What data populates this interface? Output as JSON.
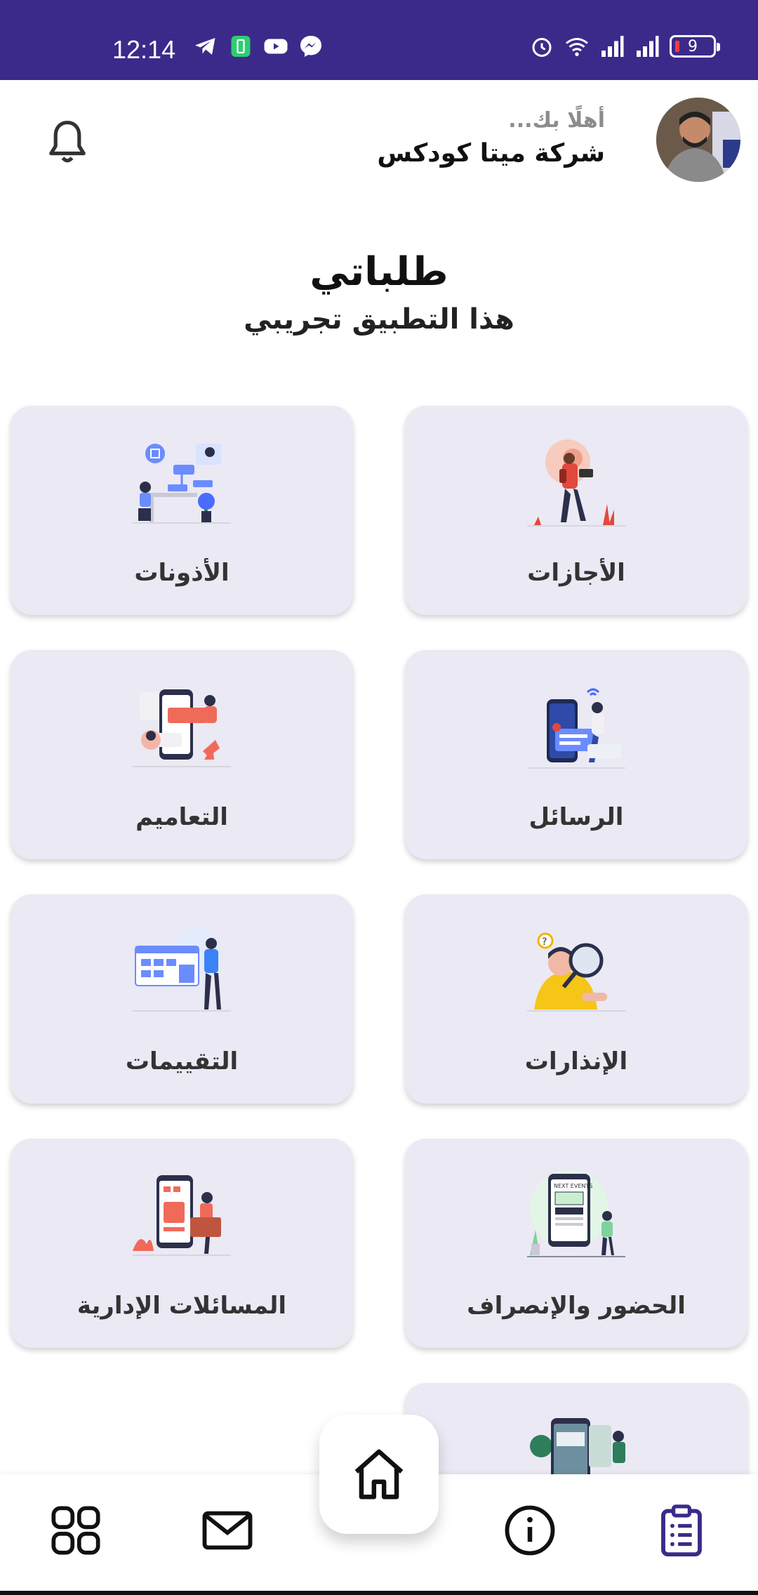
{
  "status_bar": {
    "time": "12:14",
    "battery_level": "9",
    "left_icons": [
      "telegram-icon",
      "battery-saver-icon",
      "youtube-icon",
      "messenger-icon"
    ],
    "right_icons": [
      "alarm-icon",
      "wifi-icon",
      "signal-icon",
      "signal-icon",
      "battery-icon"
    ]
  },
  "header": {
    "greeting": "أهلًا بك...",
    "company": "شركة ميتا كودكس"
  },
  "page": {
    "title": "طلباتي",
    "subtitle": "هذا التطبيق تجريبي"
  },
  "cards": [
    {
      "label": "الأجازات"
    },
    {
      "label": "الأذونات"
    },
    {
      "label": "الرسائل"
    },
    {
      "label": "التعاميم"
    },
    {
      "label": "الإنذارات"
    },
    {
      "label": "التقييمات"
    },
    {
      "label": "الحضور والإنصراف"
    },
    {
      "label": "المسائلات الإدارية"
    },
    {
      "label": ""
    }
  ],
  "bottom_nav": {
    "items": [
      "grid-icon",
      "mail-icon",
      "home-icon",
      "info-icon",
      "clipboard-icon"
    ],
    "active": "clipboard-icon",
    "accent_color": "#3b2a8a"
  },
  "colors": {
    "status_bar": "#3b2a8a",
    "card_bg": "#eae9f4"
  }
}
